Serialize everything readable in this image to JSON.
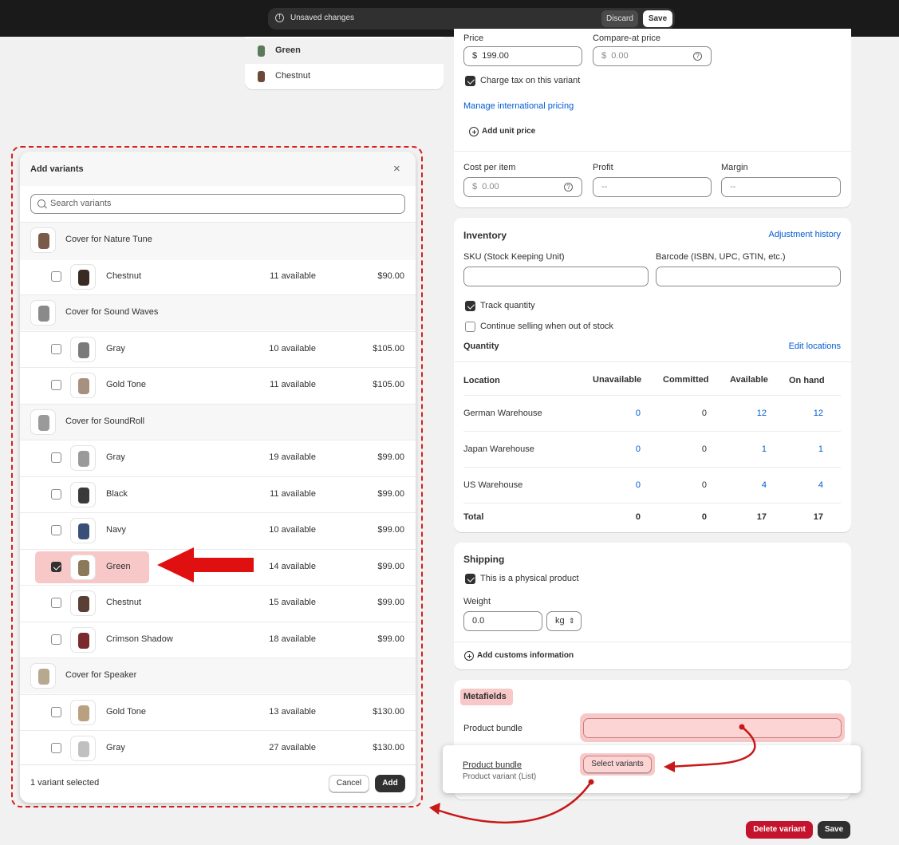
{
  "topbar": {
    "status": "Unsaved changes",
    "discard": "Discard",
    "save": "Save"
  },
  "variant_list": [
    {
      "name": "Green",
      "color": "#5a7a5a",
      "active": true
    },
    {
      "name": "Chestnut",
      "color": "#6b4a3a",
      "active": false
    }
  ],
  "pricing": {
    "price_label": "Price",
    "price_value": "199.00",
    "compare_label": "Compare-at price",
    "compare_placeholder": "0.00",
    "currency": "$",
    "charge_tax": "Charge tax on this variant",
    "intl_link": "Manage international pricing",
    "unit_price": "Add unit price",
    "cost_label": "Cost per item",
    "cost_placeholder": "0.00",
    "profit_label": "Profit",
    "profit_value": "--",
    "margin_label": "Margin",
    "margin_value": "--"
  },
  "inventory": {
    "title": "Inventory",
    "adjust_link": "Adjustment history",
    "sku_label": "SKU (Stock Keeping Unit)",
    "barcode_label": "Barcode (ISBN, UPC, GTIN, etc.)",
    "track": "Track quantity",
    "continue": "Continue selling when out of stock",
    "quantity": "Quantity",
    "edit_locations": "Edit locations",
    "columns": [
      "Location",
      "Unavailable",
      "Committed",
      "Available",
      "On hand"
    ],
    "rows": [
      {
        "location": "German Warehouse",
        "unavailable": "0",
        "committed": "0",
        "available": "12",
        "on_hand": "12"
      },
      {
        "location": "Japan Warehouse",
        "unavailable": "0",
        "committed": "0",
        "available": "1",
        "on_hand": "1"
      },
      {
        "location": "US Warehouse",
        "unavailable": "0",
        "committed": "0",
        "available": "4",
        "on_hand": "4"
      }
    ],
    "total": {
      "label": "Total",
      "unavailable": "0",
      "committed": "0",
      "available": "17",
      "on_hand": "17"
    }
  },
  "shipping": {
    "title": "Shipping",
    "physical": "This is a physical product",
    "weight_label": "Weight",
    "weight_value": "0.0",
    "unit": "kg",
    "customs": "Add customs information"
  },
  "metafields": {
    "title": "Metafields",
    "bundle_label": "Product bundle",
    "popup_name": "Product bundle",
    "popup_type": "Product variant (List)",
    "select_button": "Select variants"
  },
  "modal": {
    "title": "Add variants",
    "search_placeholder": "Search variants",
    "selected_count": "1 variant selected",
    "cancel": "Cancel",
    "add": "Add",
    "rows": [
      {
        "type": "product",
        "name": "Cover for Nature Tune",
        "color": "#7a5a48"
      },
      {
        "type": "variant",
        "name": "Chestnut",
        "available": "11 available",
        "price": "$90.00",
        "color": "#3a2a24",
        "checked": false
      },
      {
        "type": "product",
        "name": "Cover for Sound Waves",
        "color": "#8a8a8a"
      },
      {
        "type": "variant",
        "name": "Gray",
        "available": "10 available",
        "price": "$105.00",
        "color": "#7a7a7a",
        "checked": false
      },
      {
        "type": "variant",
        "name": "Gold Tone",
        "available": "11 available",
        "price": "$105.00",
        "color": "#a89080",
        "checked": false
      },
      {
        "type": "product",
        "name": "Cover for SoundRoll",
        "color": "#9a9a9a"
      },
      {
        "type": "variant",
        "name": "Gray",
        "available": "19 available",
        "price": "$99.00",
        "color": "#9a9a9a",
        "checked": false
      },
      {
        "type": "variant",
        "name": "Black",
        "available": "11 available",
        "price": "$99.00",
        "color": "#3a3a3a",
        "checked": false
      },
      {
        "type": "variant",
        "name": "Navy",
        "available": "10 available",
        "price": "$99.00",
        "color": "#3a4e7a",
        "checked": false
      },
      {
        "type": "variant",
        "name": "Green",
        "available": "14 available",
        "price": "$99.00",
        "color": "#8a7a5a",
        "checked": true
      },
      {
        "type": "variant",
        "name": "Chestnut",
        "available": "15 available",
        "price": "$99.00",
        "color": "#5a4034",
        "checked": false
      },
      {
        "type": "variant",
        "name": "Crimson Shadow",
        "available": "18 available",
        "price": "$99.00",
        "color": "#7a2a2a",
        "checked": false
      },
      {
        "type": "product",
        "name": "Cover for Speaker",
        "color": "#b8a890"
      },
      {
        "type": "variant",
        "name": "Gold Tone",
        "available": "13 available",
        "price": "$130.00",
        "color": "#b8a080",
        "checked": false
      },
      {
        "type": "variant",
        "name": "Gray",
        "available": "27 available",
        "price": "$130.00",
        "color": "#c0c0c0",
        "checked": false
      }
    ]
  },
  "footer": {
    "delete": "Delete variant",
    "save": "Save"
  },
  "colors": {
    "accent": "#005bd3",
    "danger": "#c4132c",
    "highlight": "#f8c8c8",
    "annotation": "#d42020"
  }
}
